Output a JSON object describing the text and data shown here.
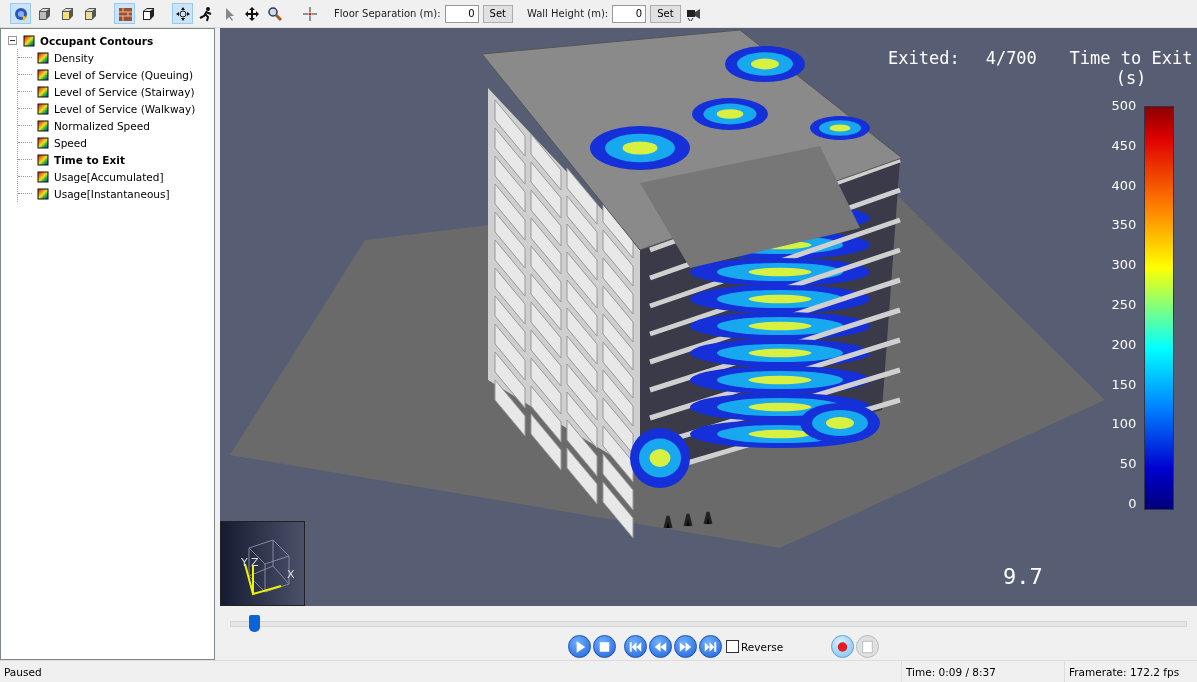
{
  "toolbar": {
    "tools": [
      {
        "kind": "view-select",
        "selected": true
      },
      {
        "kind": "cube-grey",
        "selected": false
      },
      {
        "kind": "cube-yellow",
        "selected": false
      },
      {
        "kind": "cube-side",
        "selected": false
      },
      {
        "kind": "texture",
        "selected": true
      },
      {
        "kind": "cube-dark",
        "selected": false
      },
      {
        "kind": "orbit",
        "selected": true
      },
      {
        "kind": "runner",
        "selected": false
      },
      {
        "kind": "pointer",
        "selected": false
      },
      {
        "kind": "move",
        "selected": false
      },
      {
        "kind": "zoom",
        "selected": false
      },
      {
        "kind": "center",
        "selected": false
      }
    ],
    "fields": [
      {
        "label": "Floor Separation (m):",
        "value": "0",
        "button": "Set"
      },
      {
        "label": "Wall Height (m):",
        "value": "0",
        "button": "Set"
      }
    ]
  },
  "tree": {
    "label": "Occupant Contours",
    "expanded": true,
    "children": [
      {
        "label": "Density",
        "selected": false
      },
      {
        "label": "Level of Service (Queuing)",
        "selected": false
      },
      {
        "label": "Level of Service (Stairway)",
        "selected": false
      },
      {
        "label": "Level of Service (Walkway)",
        "selected": false
      },
      {
        "label": "Normalized Speed",
        "selected": false
      },
      {
        "label": "Speed",
        "selected": false
      },
      {
        "label": "Time to Exit",
        "selected": true
      },
      {
        "label": "Usage[Accumulated]",
        "selected": false
      },
      {
        "label": "Usage[Instantaneous]",
        "selected": false
      }
    ]
  },
  "viewport": {
    "exited_label": "Exited:",
    "exited_value": "4/700",
    "legend": {
      "title": "Time to Exit",
      "unit": "(s)",
      "ticks": [
        "500",
        "450",
        "400",
        "350",
        "300",
        "250",
        "200",
        "150",
        "100",
        "50",
        "0"
      ]
    },
    "axes": [
      "Y",
      "Z",
      "X"
    ],
    "time": "9.7"
  },
  "playback": {
    "position": {
      "level": 0.024
    },
    "buttons": [
      {
        "kind": "play"
      },
      {
        "kind": "stop"
      },
      {
        "kind": "skip-start"
      },
      {
        "kind": "rewind"
      },
      {
        "kind": "fast-forward"
      },
      {
        "kind": "skip-end"
      }
    ],
    "reverse": {
      "label": "Reverse",
      "checked": false
    },
    "record_buttons": [
      {
        "kind": "record",
        "disabled": false
      },
      {
        "kind": "stop-record",
        "disabled": true
      }
    ]
  },
  "status_bar": {
    "state": "Paused",
    "time": "Time: 0:09 / 8:37",
    "framerate": "Framerate: 172.2 fps"
  }
}
